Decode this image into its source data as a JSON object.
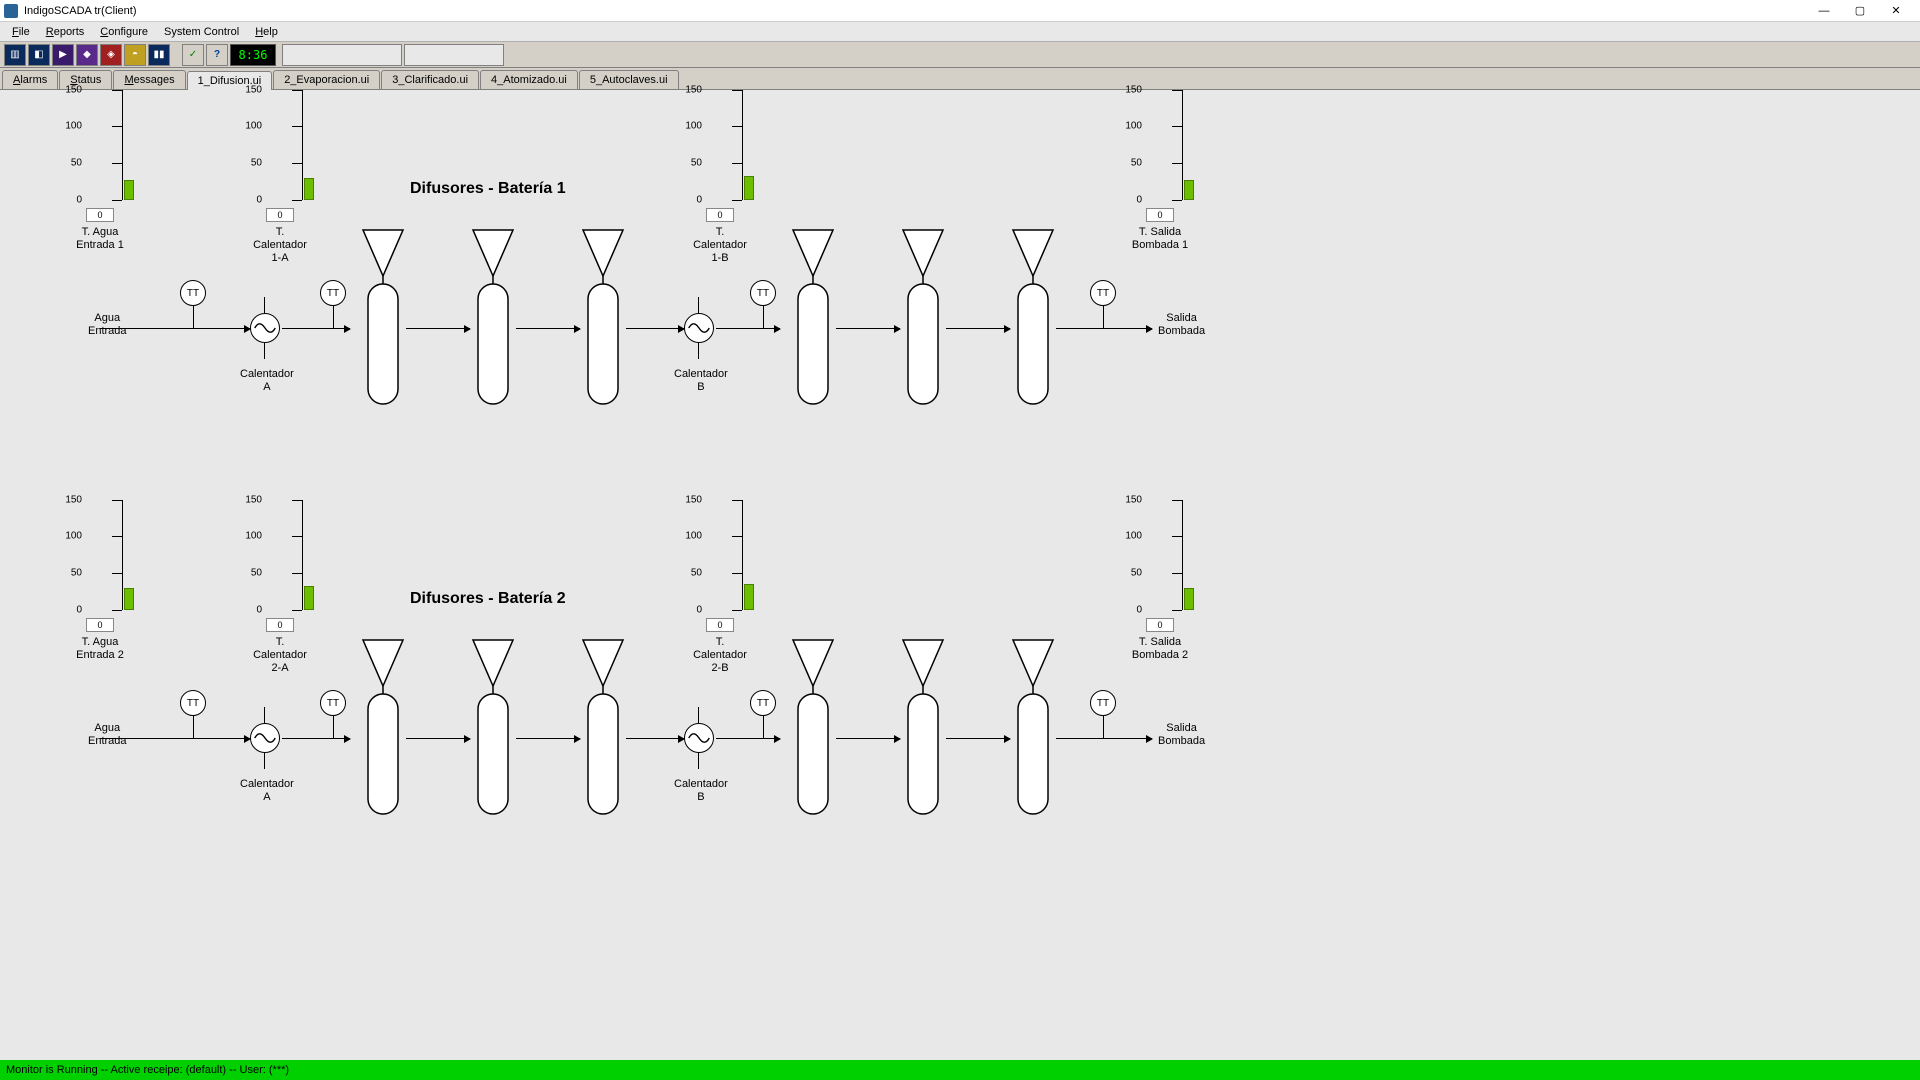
{
  "window": {
    "title": "IndigoSCADA tr(Client)"
  },
  "menu": {
    "file": "File",
    "reports": "Reports",
    "configure": "Configure",
    "system_control": "System Control",
    "help": "Help"
  },
  "toolbar": {
    "clock": "8:36"
  },
  "tabs": [
    {
      "label": "Alarms"
    },
    {
      "label": "Status"
    },
    {
      "label": "Messages"
    },
    {
      "label": "1_Difusion.ui",
      "active": true
    },
    {
      "label": "2_Evaporacion.ui"
    },
    {
      "label": "3_Clarificado.ui"
    },
    {
      "label": "4_Atomizado.ui"
    },
    {
      "label": "5_Autoclaves.ui"
    }
  ],
  "section1": {
    "title": "Difusores - Batería 1"
  },
  "section2": {
    "title": "Difusores - Batería 2"
  },
  "gauges": {
    "scale": {
      "max": "150",
      "t100": "100",
      "t50": "50",
      "t0": "0"
    },
    "g1_1": {
      "caption1": "T. Agua",
      "caption2": "Entrada 1",
      "box": "0",
      "barPct": 18
    },
    "g1_2": {
      "caption1": "T. Calentador",
      "caption2": "1-A",
      "box": "0",
      "barPct": 20
    },
    "g1_3": {
      "caption1": "T. Calentador",
      "caption2": "1-B",
      "box": "0",
      "barPct": 22
    },
    "g1_4": {
      "caption1": "T. Salida",
      "caption2": "Bombada 1",
      "box": "0",
      "barPct": 18
    },
    "g2_1": {
      "caption1": "T. Agua",
      "caption2": "Entrada 2",
      "box": "0",
      "barPct": 20
    },
    "g2_2": {
      "caption1": "T. Calentador",
      "caption2": "2-A",
      "box": "0",
      "barPct": 22
    },
    "g2_3": {
      "caption1": "T. Calentador",
      "caption2": "2-B",
      "box": "0",
      "barPct": 24
    },
    "g2_4": {
      "caption1": "T. Salida",
      "caption2": "Bombada 2",
      "box": "0",
      "barPct": 20
    }
  },
  "labels": {
    "agua_entrada": "Agua\nEntrada",
    "salida_bombada": "Salida\nBombada",
    "calentador_a": "Calentador\nA",
    "calentador_b": "Calentador\nB",
    "tt": "TT"
  },
  "status": {
    "text": "Monitor is Running -- Active receipe: (default) -- User: (***)"
  }
}
